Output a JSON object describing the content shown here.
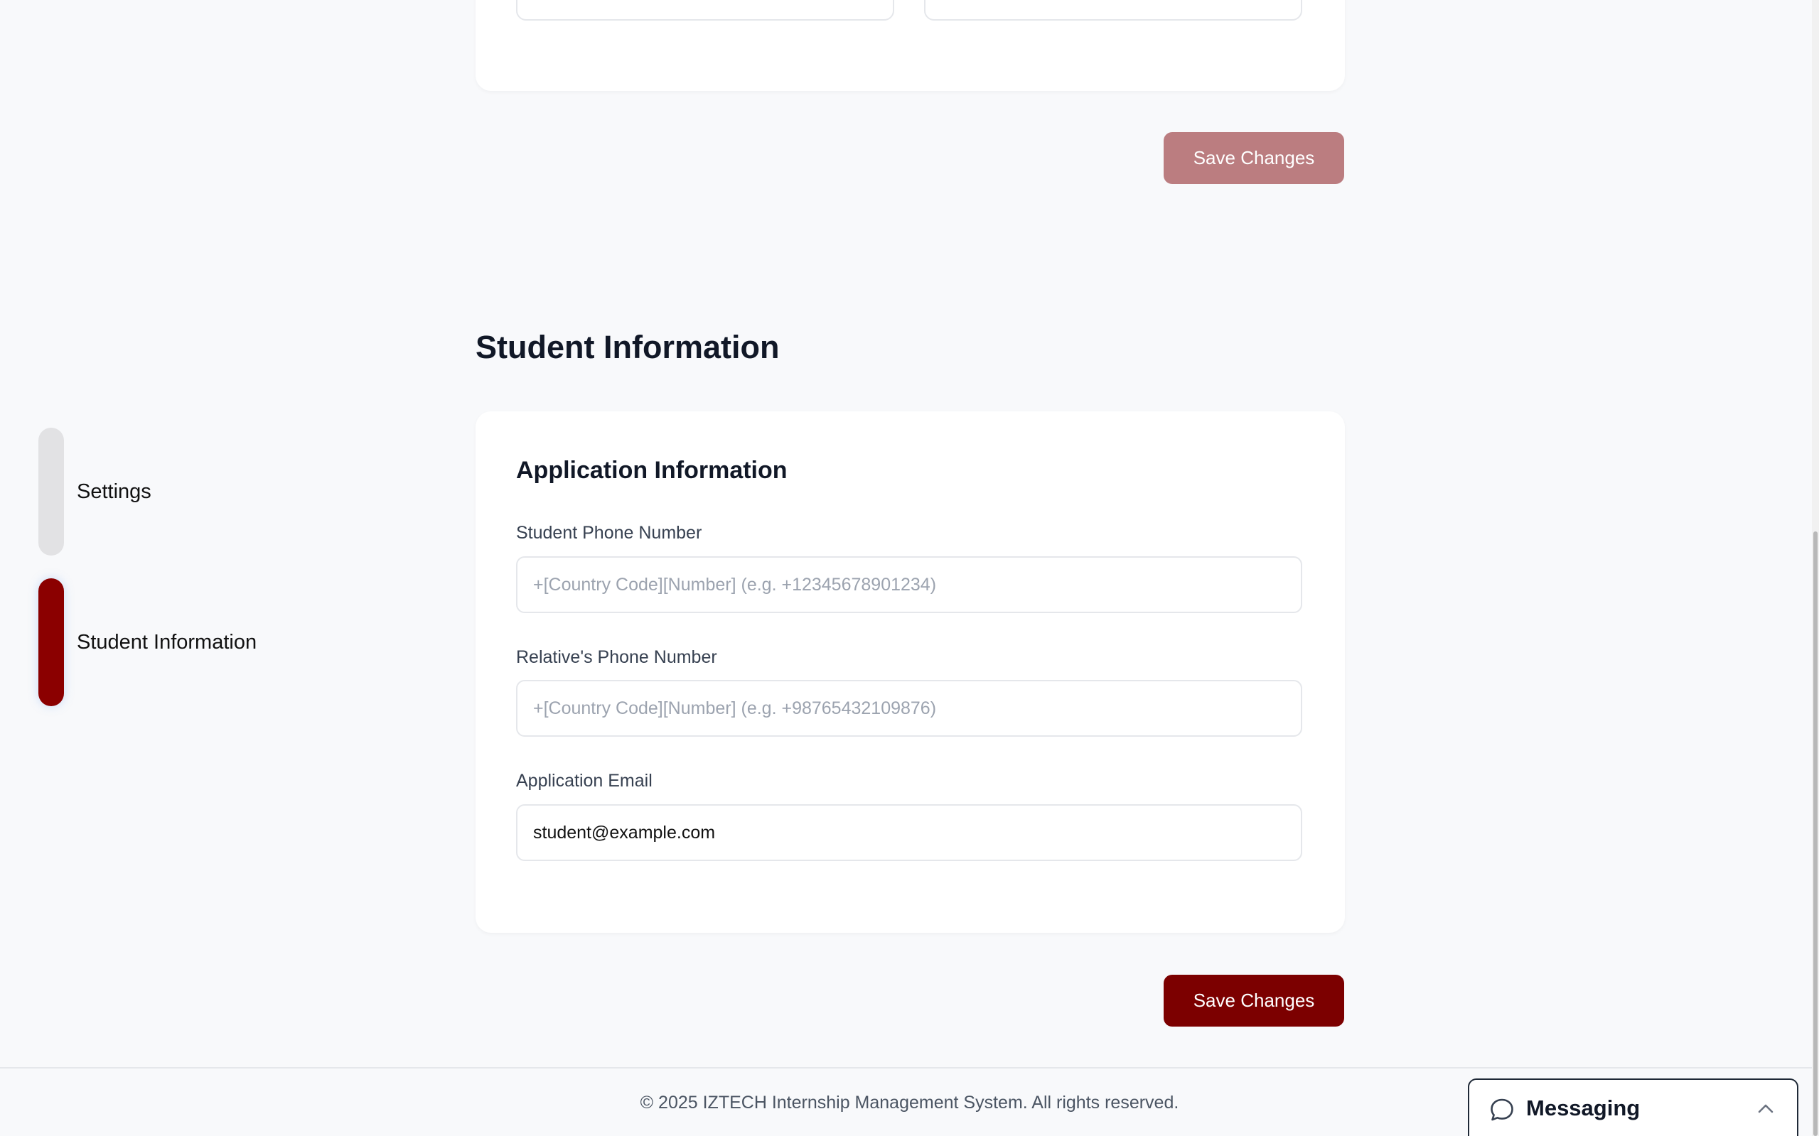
{
  "sidebar": {
    "items": [
      {
        "label": "Settings",
        "active": false
      },
      {
        "label": "Student Information",
        "active": true
      }
    ]
  },
  "password_section": {
    "field_icons": [
      "eye-icon",
      "eye-icon"
    ],
    "save_label": "Save Changes",
    "save_disabled": true
  },
  "student_section": {
    "title": "Student Information",
    "card_title": "Application Information",
    "fields": [
      {
        "label": "Student Phone Number",
        "value": "",
        "placeholder": "+[Country Code][Number] (e.g. +12345678901234)"
      },
      {
        "label": "Relative's Phone Number",
        "value": "",
        "placeholder": "+[Country Code][Number] (e.g. +98765432109876)"
      },
      {
        "label": "Application Email",
        "value": "student@example.com",
        "placeholder": ""
      }
    ],
    "save_label": "Save Changes"
  },
  "footer": {
    "text": "© 2025 IZTECH Internship Management System. All rights reserved."
  },
  "messaging": {
    "title": "Messaging",
    "icon": "chat-bubble-icon",
    "toggle_icon": "chevron-up-icon"
  },
  "colors": {
    "accent": "#7c0000",
    "accent_disabled": "#bb7d80",
    "nav_active": "#8b0000",
    "nav_inactive": "#e2e2e4",
    "background": "#f8f9fb"
  }
}
